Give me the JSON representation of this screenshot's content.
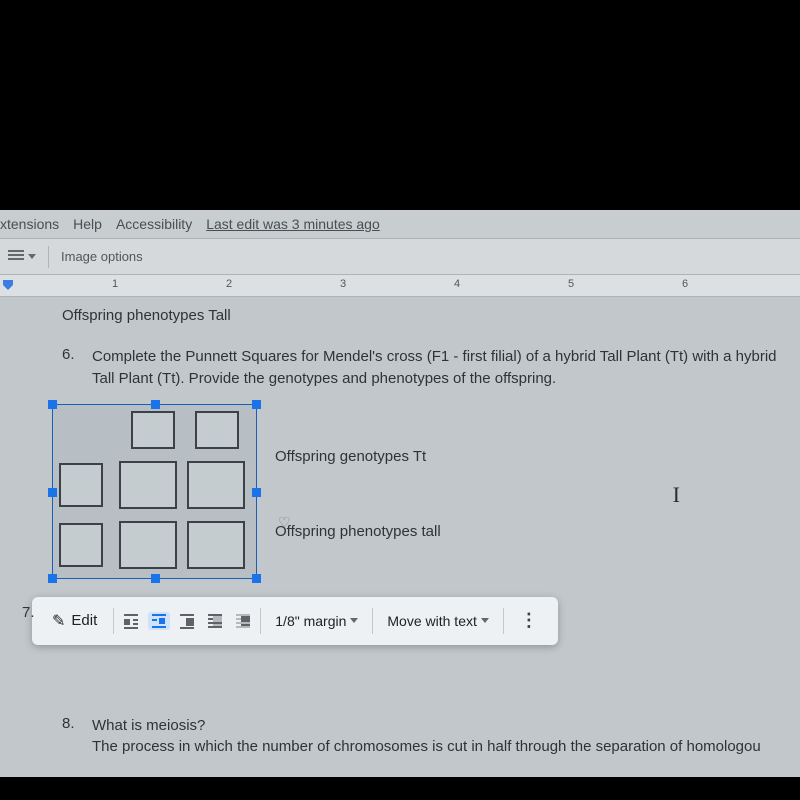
{
  "menu": {
    "extensions": "xtensions",
    "help": "Help",
    "accessibility": "Accessibility",
    "last_edit": "Last edit was 3 minutes ago"
  },
  "toolbar_top": {
    "image_options": "Image options"
  },
  "ruler_marks": [
    "1",
    "2",
    "3",
    "4",
    "5",
    "6"
  ],
  "doc": {
    "line_above": "Offspring phenotypes Tall",
    "q6_num": "6.",
    "q6_text": "Complete the Punnett Squares for Mendel's cross (F1 - first filial) of a hybrid Tall Plant (Tt) with a hybrid Tall Plant (Tt).  Provide the genotypes and phenotypes of the offspring.",
    "genotypes_label": "Offspring genotypes Tt",
    "phenotypes_label": "Offspring phenotypes tall",
    "q7_num": "7.",
    "q8_num": "8.",
    "q8_title": "What is meiosis?",
    "q8_body": "The process in which the number of chromosomes is cut in half through the separation of homologou"
  },
  "image_toolbar": {
    "edit": "Edit",
    "margin": "1/8\" margin",
    "move": "Move with text"
  }
}
